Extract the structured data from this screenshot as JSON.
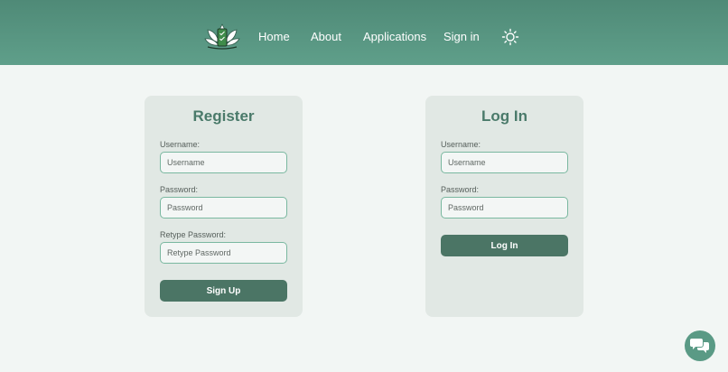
{
  "nav": {
    "home": "Home",
    "about": "About",
    "applications": "Applications",
    "sign_in": "Sign in"
  },
  "register": {
    "title": "Register",
    "username_label": "Username:",
    "username_placeholder": "Username",
    "password_label": "Password:",
    "password_placeholder": "Password",
    "retype_label": "Retype Password:",
    "retype_placeholder": "Retype Password",
    "submit_label": "Sign Up"
  },
  "login": {
    "title": "Log In",
    "username_label": "Username:",
    "username_placeholder": "Username",
    "password_label": "Password:",
    "password_placeholder": "Password",
    "submit_label": "Log In"
  },
  "icons": {
    "logo": "lotus-logo-icon",
    "theme": "sun-icon",
    "chat": "chat-bubbles-icon"
  },
  "colors": {
    "header": "#5a9783",
    "accent": "#4b7565",
    "card": "#e1e8e4",
    "input_border": "#7ab8a0"
  }
}
